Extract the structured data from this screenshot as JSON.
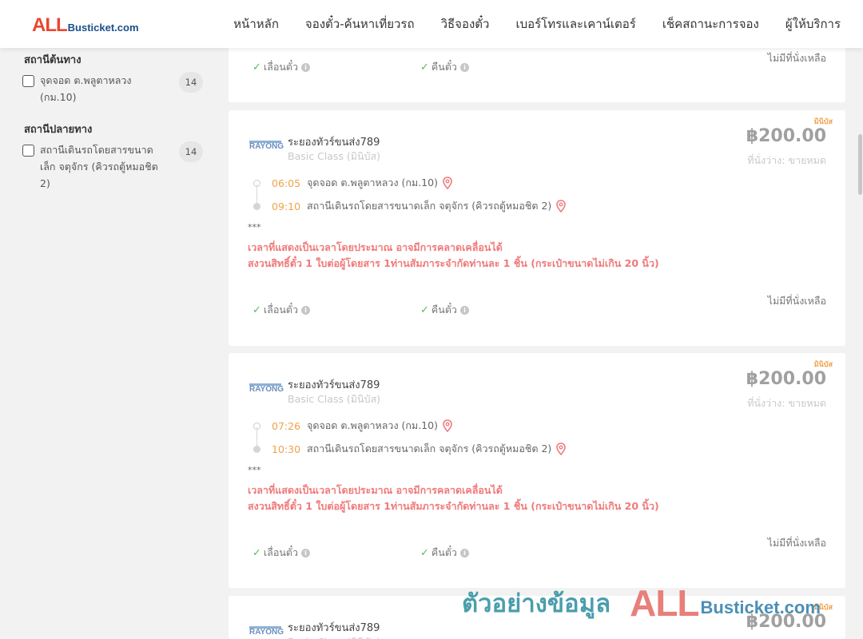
{
  "brand": {
    "logo_all": "ALL",
    "logo_rest": "Busticket.com"
  },
  "nav": [
    "หน้าหลัก",
    "จองตั๋ว-ค้นหาเที่ยวรถ",
    "วิธีจองตั๋ว",
    "เบอร์โทรและเคาน์เตอร์",
    "เช็คสถานะการจอง",
    "ผู้ให้บริการ"
  ],
  "sidebar": {
    "origin_title": "สถานีต้นทาง",
    "origin_option": {
      "label": "จุดจอด ต.พลูตาหลวง (กม.10)",
      "count": "14"
    },
    "dest_title": "สถานีปลายทาง",
    "dest_option": {
      "label": "สถานีเดินรถโดยสารขนาดเล็ก จตุจักร (คิวรถตู้หมอชิต 2)",
      "count": "14"
    }
  },
  "common": {
    "badge": "มินิบัส",
    "operator_logo": "RAYONG",
    "operator": "ระยองทัวร์ขนส่ง789",
    "bus_class": "Basic Class (มินิบัส)",
    "price": "฿200.00",
    "seats": "ที่นั่งว่าง: ขายหมด",
    "stars": "***",
    "note1": "เวลาที่แสดงเป็นเวลาโดยประมาณ อาจมีการคลาดเคลื่อนได้",
    "note2": "สงวนสิทธิ์ตั๋ว 1 ใบต่อผู้โดยสาร 1ท่านสัมภาระจำกัดท่านละ 1 ชิ้น (กระเป๋าขนาดไม่เกิน 20 นิ้ว)",
    "reschedule": "เลื่อนตั๋ว",
    "refund": "คืนตั๋ว",
    "no_seat": "ไม่มีที่นั่งเหลือ",
    "depart_stop": "จุดจอด ต.พลูตาหลวง (กม.10)",
    "arrive_stop": "สถานีเดินรถโดยสารขนาดเล็ก จตุจักร (คิวรถตู้หมอชิต 2)"
  },
  "trips": [
    {
      "depart": "06:05",
      "arrive": "09:10"
    },
    {
      "depart": "07:26",
      "arrive": "10:30"
    }
  ],
  "watermark": {
    "text_th": "ตัวอย่างข้อมูล",
    "all": "ALL",
    "rest": "Busticket.com"
  },
  "colors": {
    "brand_red": "#e8472f",
    "brand_blue": "#1a4f8b",
    "time_orange": "#f0a24a",
    "note_red": "#f07a7a",
    "check_green": "#5cb85c"
  }
}
